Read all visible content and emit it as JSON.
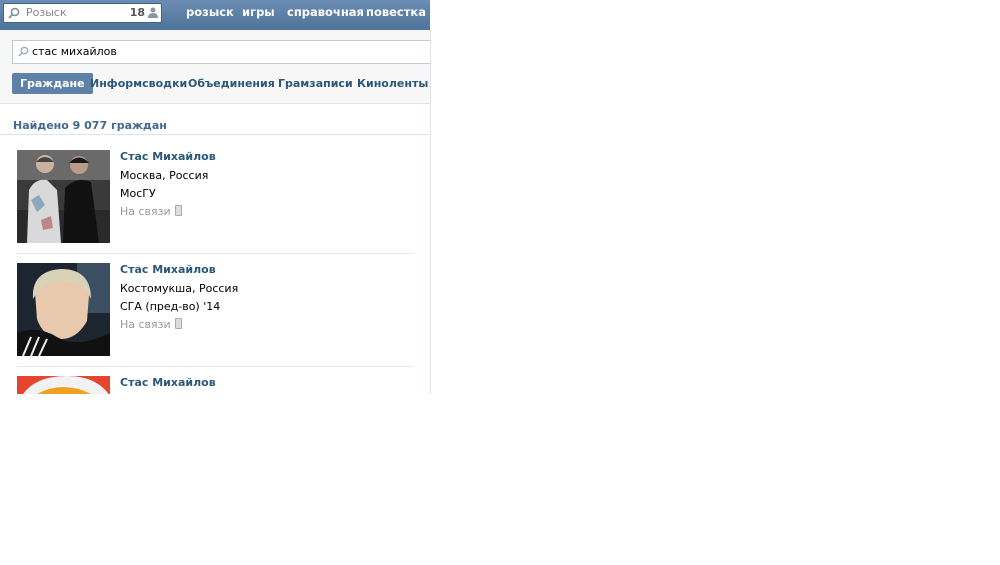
{
  "header": {
    "search_placeholder": "Розыск",
    "search_count": "18",
    "nav": [
      {
        "label": "розыск"
      },
      {
        "label": "игры"
      },
      {
        "label": "справочная"
      },
      {
        "label": "повестка"
      }
    ]
  },
  "search": {
    "query": "стас михайлов"
  },
  "tabs": [
    {
      "label": "Граждане",
      "active": true
    },
    {
      "label": "Информсводки",
      "active": false
    },
    {
      "label": "Объединения",
      "active": false
    },
    {
      "label": "Грамзаписи",
      "active": false
    },
    {
      "label": "Киноленты",
      "active": false
    }
  ],
  "results": {
    "found_label": "Найдено 9 077 граждан",
    "people": [
      {
        "name": "Стас Михайлов",
        "city": "Москва, Россия",
        "university": "МосГУ",
        "status": "На связи"
      },
      {
        "name": "Стас Михайлов",
        "city": "Костомукша, Россия",
        "university": "СГА (пред-во) '14",
        "status": "На связи"
      },
      {
        "name": "Стас Михайлов",
        "city": "",
        "university": "",
        "status": ""
      }
    ]
  },
  "colors": {
    "header_bg": "#5b7ea3",
    "link": "#2b587a",
    "active_tab": "#5e81a8",
    "found_text": "#45688e"
  }
}
